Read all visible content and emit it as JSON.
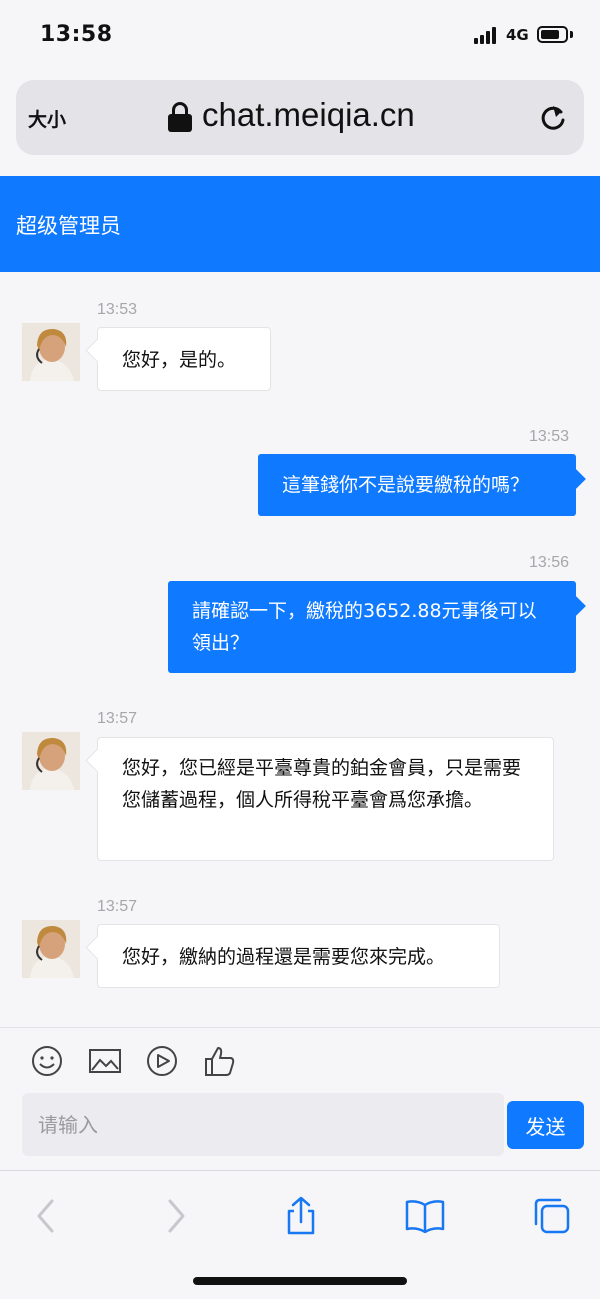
{
  "status_bar": {
    "time": "13:58",
    "network": "4G",
    "battery_level": 0.8
  },
  "address_bar": {
    "text_size_label": "大小",
    "url": "chat.meiqia.cn"
  },
  "chat": {
    "title": "超级管理员",
    "messages": [
      {
        "sender": "agent",
        "time": "13:53",
        "text": "您好，是的。"
      },
      {
        "sender": "user",
        "time": "13:53",
        "text": "這筆錢你不是說要繳稅的嗎？"
      },
      {
        "sender": "user",
        "time": "13:56",
        "text": "請確認一下，繳稅的3652.88元事後可以領出？"
      },
      {
        "sender": "agent",
        "time": "13:57",
        "text": "您好，您已經是平臺尊貴的鉑金會員，只是需要您儲蓄過程，個人所得稅平臺會爲您承擔。"
      },
      {
        "sender": "agent",
        "time": "13:57",
        "text": "您好，繳納的過程還是需要您來完成。"
      }
    ]
  },
  "input": {
    "placeholder": "请输入",
    "value": "",
    "send_label": "发送"
  },
  "toolbar_icons": [
    "emoji-icon",
    "image-icon",
    "video-icon",
    "thumbs-up-icon"
  ],
  "browser_toolbar": [
    "back-icon",
    "forward-icon",
    "share-icon",
    "bookmarks-icon",
    "tabs-icon"
  ],
  "colors": {
    "accent": "#0f79ff",
    "agent_bubble": "#ffffff",
    "background": "#f6f6f8"
  }
}
